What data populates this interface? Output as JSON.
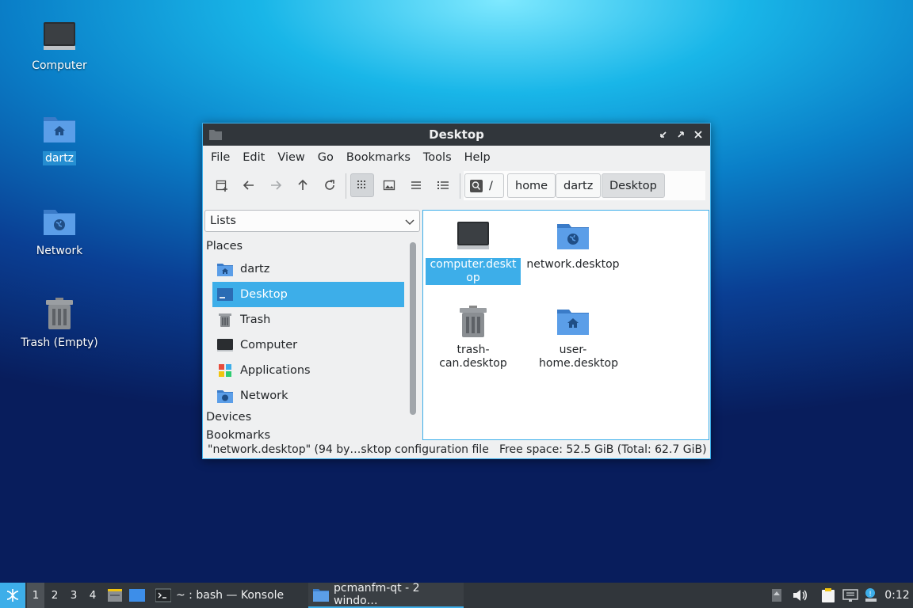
{
  "desktop": {
    "icons": [
      {
        "label": "Computer"
      },
      {
        "label": "dartz"
      },
      {
        "label": "Network"
      },
      {
        "label": "Trash (Empty)"
      }
    ]
  },
  "window": {
    "title": "Desktop",
    "menu": [
      "File",
      "Edit",
      "View",
      "Go",
      "Bookmarks",
      "Tools",
      "Help"
    ],
    "path": {
      "root": "/",
      "segments": [
        "home",
        "dartz",
        "Desktop"
      ]
    },
    "side_pane": {
      "mode": "Lists",
      "places_header": "Places",
      "places": [
        {
          "label": "dartz",
          "icon": "user-home-icon"
        },
        {
          "label": "Desktop",
          "icon": "desktop-icon"
        },
        {
          "label": "Trash",
          "icon": "trash-icon"
        },
        {
          "label": "Computer",
          "icon": "computer-icon"
        },
        {
          "label": "Applications",
          "icon": "applications-icon"
        },
        {
          "label": "Network",
          "icon": "network-icon"
        }
      ],
      "devices_header": "Devices",
      "bookmarks_header": "Bookmarks"
    },
    "files": [
      {
        "name": "computer.desktop"
      },
      {
        "name": "network.desktop"
      },
      {
        "name": "trash-can.desktop"
      },
      {
        "name": "user-home.desktop"
      }
    ],
    "status": {
      "selection": "\"network.desktop\" (94 by…sktop configuration file",
      "free_space": "Free space: 52.5 GiB (Total: 62.7 GiB)"
    }
  },
  "taskbar": {
    "desktops": [
      "1",
      "2",
      "3",
      "4"
    ],
    "tasks": [
      {
        "label": "~ : bash — Konsole"
      },
      {
        "label": "pcmanfm-qt - 2 windo…"
      }
    ],
    "clock": "0:12"
  },
  "colors": {
    "accent": "#3daee9",
    "titlebar": "#31363b",
    "folder": "#4a8fd8"
  }
}
